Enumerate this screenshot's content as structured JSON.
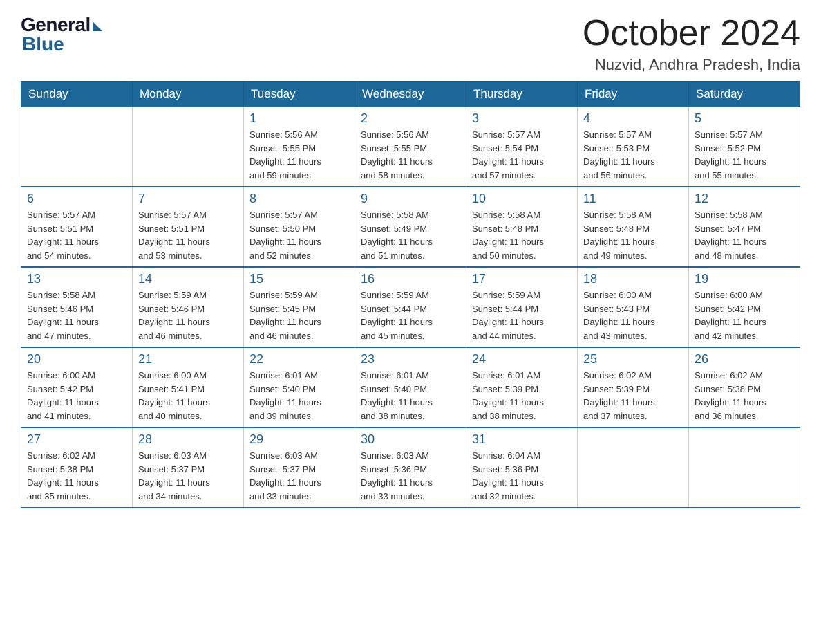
{
  "header": {
    "logo": {
      "general": "General",
      "blue": "Blue"
    },
    "title": "October 2024",
    "location": "Nuzvid, Andhra Pradesh, India"
  },
  "calendar": {
    "days_of_week": [
      "Sunday",
      "Monday",
      "Tuesday",
      "Wednesday",
      "Thursday",
      "Friday",
      "Saturday"
    ],
    "weeks": [
      [
        {
          "day": "",
          "info": ""
        },
        {
          "day": "",
          "info": ""
        },
        {
          "day": "1",
          "info": "Sunrise: 5:56 AM\nSunset: 5:55 PM\nDaylight: 11 hours\nand 59 minutes."
        },
        {
          "day": "2",
          "info": "Sunrise: 5:56 AM\nSunset: 5:55 PM\nDaylight: 11 hours\nand 58 minutes."
        },
        {
          "day": "3",
          "info": "Sunrise: 5:57 AM\nSunset: 5:54 PM\nDaylight: 11 hours\nand 57 minutes."
        },
        {
          "day": "4",
          "info": "Sunrise: 5:57 AM\nSunset: 5:53 PM\nDaylight: 11 hours\nand 56 minutes."
        },
        {
          "day": "5",
          "info": "Sunrise: 5:57 AM\nSunset: 5:52 PM\nDaylight: 11 hours\nand 55 minutes."
        }
      ],
      [
        {
          "day": "6",
          "info": "Sunrise: 5:57 AM\nSunset: 5:51 PM\nDaylight: 11 hours\nand 54 minutes."
        },
        {
          "day": "7",
          "info": "Sunrise: 5:57 AM\nSunset: 5:51 PM\nDaylight: 11 hours\nand 53 minutes."
        },
        {
          "day": "8",
          "info": "Sunrise: 5:57 AM\nSunset: 5:50 PM\nDaylight: 11 hours\nand 52 minutes."
        },
        {
          "day": "9",
          "info": "Sunrise: 5:58 AM\nSunset: 5:49 PM\nDaylight: 11 hours\nand 51 minutes."
        },
        {
          "day": "10",
          "info": "Sunrise: 5:58 AM\nSunset: 5:48 PM\nDaylight: 11 hours\nand 50 minutes."
        },
        {
          "day": "11",
          "info": "Sunrise: 5:58 AM\nSunset: 5:48 PM\nDaylight: 11 hours\nand 49 minutes."
        },
        {
          "day": "12",
          "info": "Sunrise: 5:58 AM\nSunset: 5:47 PM\nDaylight: 11 hours\nand 48 minutes."
        }
      ],
      [
        {
          "day": "13",
          "info": "Sunrise: 5:58 AM\nSunset: 5:46 PM\nDaylight: 11 hours\nand 47 minutes."
        },
        {
          "day": "14",
          "info": "Sunrise: 5:59 AM\nSunset: 5:46 PM\nDaylight: 11 hours\nand 46 minutes."
        },
        {
          "day": "15",
          "info": "Sunrise: 5:59 AM\nSunset: 5:45 PM\nDaylight: 11 hours\nand 46 minutes."
        },
        {
          "day": "16",
          "info": "Sunrise: 5:59 AM\nSunset: 5:44 PM\nDaylight: 11 hours\nand 45 minutes."
        },
        {
          "day": "17",
          "info": "Sunrise: 5:59 AM\nSunset: 5:44 PM\nDaylight: 11 hours\nand 44 minutes."
        },
        {
          "day": "18",
          "info": "Sunrise: 6:00 AM\nSunset: 5:43 PM\nDaylight: 11 hours\nand 43 minutes."
        },
        {
          "day": "19",
          "info": "Sunrise: 6:00 AM\nSunset: 5:42 PM\nDaylight: 11 hours\nand 42 minutes."
        }
      ],
      [
        {
          "day": "20",
          "info": "Sunrise: 6:00 AM\nSunset: 5:42 PM\nDaylight: 11 hours\nand 41 minutes."
        },
        {
          "day": "21",
          "info": "Sunrise: 6:00 AM\nSunset: 5:41 PM\nDaylight: 11 hours\nand 40 minutes."
        },
        {
          "day": "22",
          "info": "Sunrise: 6:01 AM\nSunset: 5:40 PM\nDaylight: 11 hours\nand 39 minutes."
        },
        {
          "day": "23",
          "info": "Sunrise: 6:01 AM\nSunset: 5:40 PM\nDaylight: 11 hours\nand 38 minutes."
        },
        {
          "day": "24",
          "info": "Sunrise: 6:01 AM\nSunset: 5:39 PM\nDaylight: 11 hours\nand 38 minutes."
        },
        {
          "day": "25",
          "info": "Sunrise: 6:02 AM\nSunset: 5:39 PM\nDaylight: 11 hours\nand 37 minutes."
        },
        {
          "day": "26",
          "info": "Sunrise: 6:02 AM\nSunset: 5:38 PM\nDaylight: 11 hours\nand 36 minutes."
        }
      ],
      [
        {
          "day": "27",
          "info": "Sunrise: 6:02 AM\nSunset: 5:38 PM\nDaylight: 11 hours\nand 35 minutes."
        },
        {
          "day": "28",
          "info": "Sunrise: 6:03 AM\nSunset: 5:37 PM\nDaylight: 11 hours\nand 34 minutes."
        },
        {
          "day": "29",
          "info": "Sunrise: 6:03 AM\nSunset: 5:37 PM\nDaylight: 11 hours\nand 33 minutes."
        },
        {
          "day": "30",
          "info": "Sunrise: 6:03 AM\nSunset: 5:36 PM\nDaylight: 11 hours\nand 33 minutes."
        },
        {
          "day": "31",
          "info": "Sunrise: 6:04 AM\nSunset: 5:36 PM\nDaylight: 11 hours\nand 32 minutes."
        },
        {
          "day": "",
          "info": ""
        },
        {
          "day": "",
          "info": ""
        }
      ]
    ]
  }
}
